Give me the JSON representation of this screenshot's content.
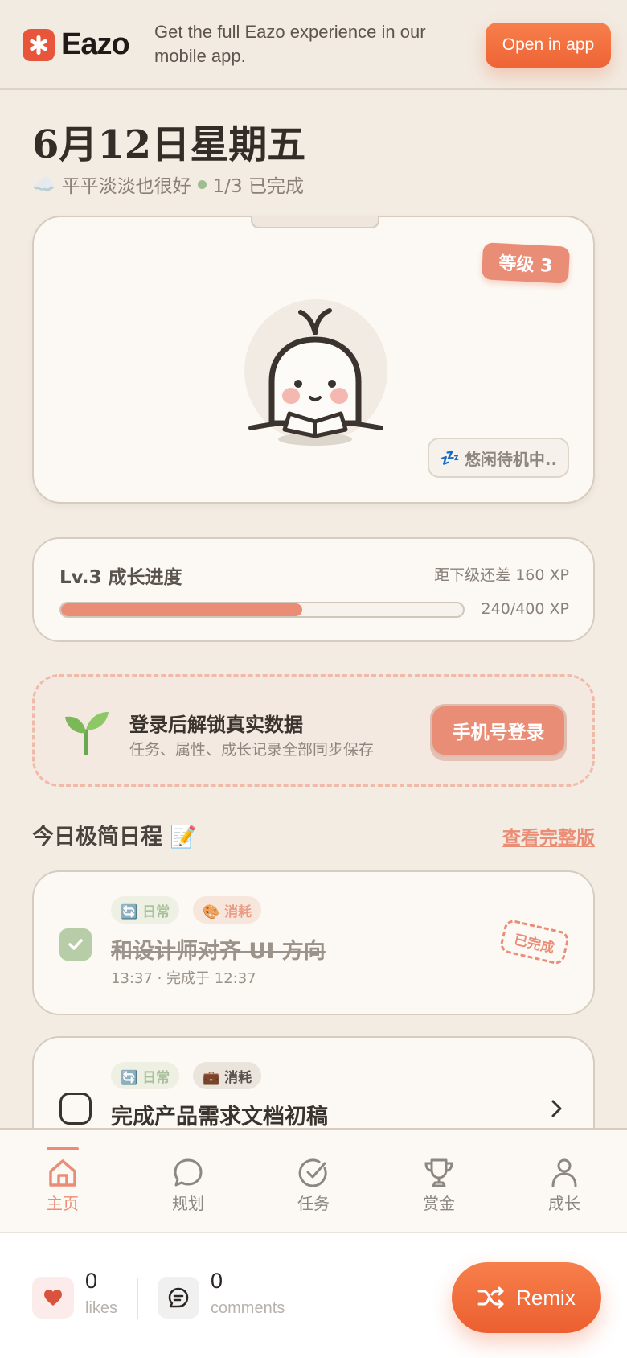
{
  "banner": {
    "brand_name": "Eazo",
    "message": "Get the full Eazo experience in our mobile app.",
    "open_app_label": "Open in app",
    "brand_color": "#e8553a"
  },
  "header": {
    "date": "6月12日星期五",
    "weather_icon": "☁️",
    "mood": "平平淡淡也很好",
    "completion": "1/3 已完成"
  },
  "pet": {
    "level_badge": "等级 3",
    "status_icon": "💤",
    "status": "悠闲待机中.."
  },
  "progress": {
    "title": "Lv.3 成长进度",
    "remaining": "距下级还差 160 XP",
    "count": "240/400 XP",
    "fraction": 0.6
  },
  "login": {
    "icon": "🌱",
    "title": "登录后解锁真实数据",
    "subtitle": "任务、属性、成长记录全部同步保存",
    "button": "手机号登录"
  },
  "schedule": {
    "title": "今日极简日程 📝",
    "view_full": "查看完整版",
    "tasks": [
      {
        "tag_daily": "🔄 日常",
        "tag_consume": "🎨 消耗",
        "name": "和设计师对齐 UI 方向",
        "meta": "13:37 · 完成于 12:37",
        "done_stamp": "已完成",
        "done": true
      },
      {
        "tag_daily": "🔄 日常",
        "tag_consume": "💼 消耗",
        "name": "完成产品需求文档初稿",
        "done": false
      }
    ]
  },
  "tabbar": {
    "items": [
      {
        "label": "主页",
        "icon": "home-icon",
        "active": true
      },
      {
        "label": "规划",
        "icon": "chat-bubble-icon"
      },
      {
        "label": "任务",
        "icon": "check-circle-icon"
      },
      {
        "label": "赏金",
        "icon": "trophy-icon"
      },
      {
        "label": "成长",
        "icon": "user-icon"
      }
    ],
    "accent": "#ea8d76"
  },
  "social": {
    "likes_count": "0",
    "likes_label": "likes",
    "comments_count": "0",
    "comments_label": "comments",
    "remix_label": "Remix"
  }
}
